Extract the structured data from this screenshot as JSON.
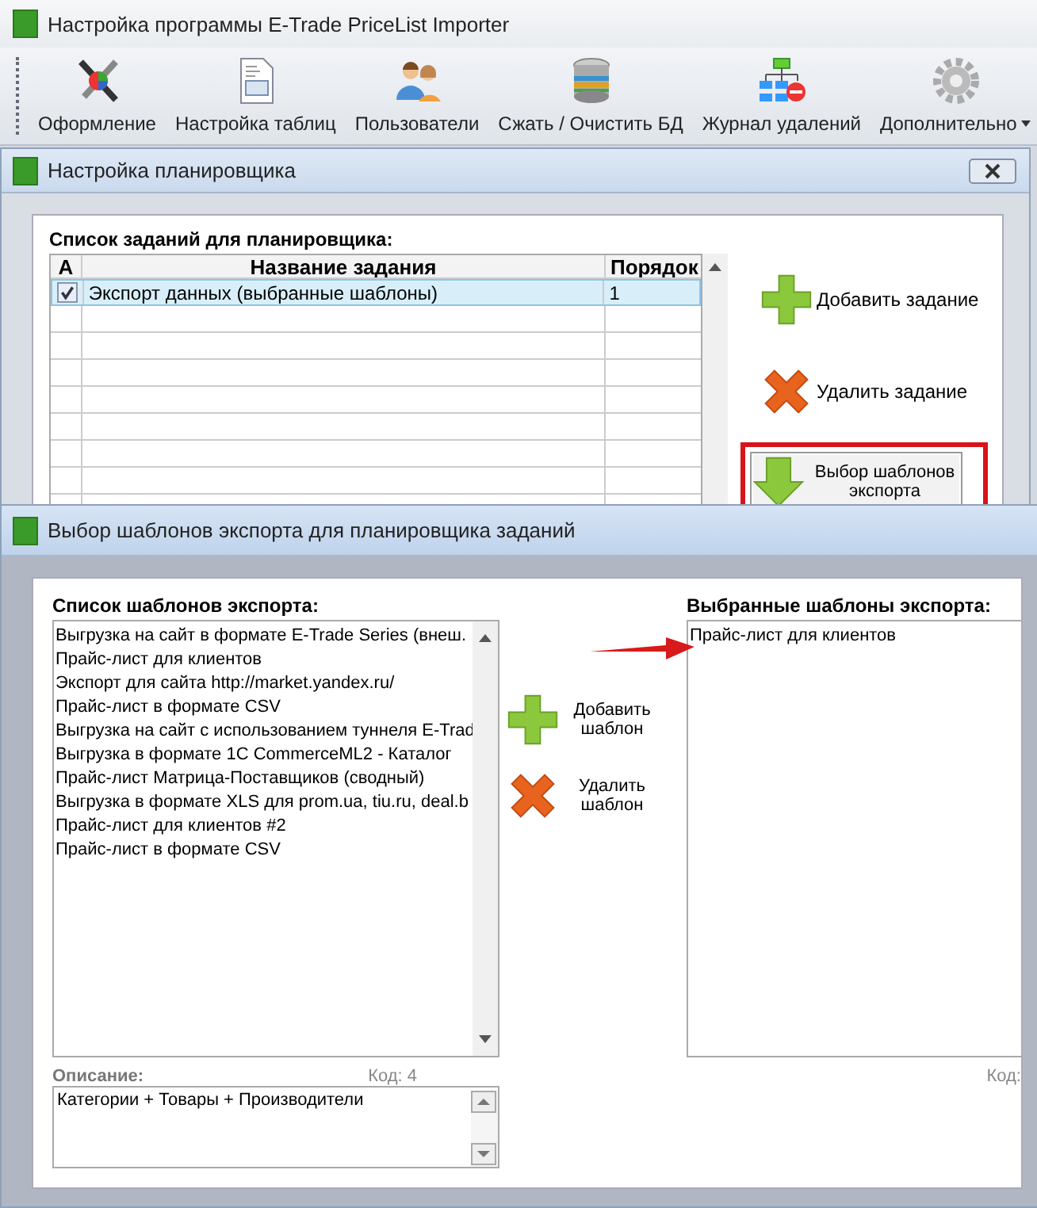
{
  "window": {
    "title": "Настройка программы E-Trade PriceList Importer"
  },
  "toolbar": [
    {
      "kind": "tools",
      "label": "Оформление",
      "menu": false
    },
    {
      "kind": "document",
      "label": "Настройка таблиц",
      "menu": false
    },
    {
      "kind": "users",
      "label": "Пользователи",
      "menu": false
    },
    {
      "kind": "database",
      "label": "Сжать / Очистить БД",
      "menu": false
    },
    {
      "kind": "hierarchy",
      "label": "Журнал удалений",
      "menu": false
    },
    {
      "kind": "gear",
      "label": "Дополнительно",
      "menu": true
    }
  ],
  "scheduler_dialog": {
    "title": "Настройка планировщика",
    "tasks_label": "Список заданий для планировщика:",
    "table": {
      "columns": [
        "А",
        "Название задания",
        "Порядок"
      ],
      "rows": [
        {
          "active": true,
          "name": "Экспорт данных (выбранные шаблоны)",
          "order": "1",
          "selected": true
        }
      ]
    },
    "buttons": [
      {
        "kind": "add",
        "label": "Добавить задание",
        "highlighted": false
      },
      {
        "kind": "delete",
        "label": "Удалить задание",
        "highlighted": false
      },
      {
        "kind": "down",
        "label": "Выбор шаблонов экспорта",
        "highlighted": true
      }
    ]
  },
  "templates_dialog": {
    "title": "Выбор шаблонов экспорта для планировщика заданий",
    "list_label": "Список шаблонов экспорта:",
    "templates": [
      "Выгрузка на сайт в формате E-Trade Series (внеш.",
      "Прайс-лист для клиентов",
      "Экспорт для сайта http://market.yandex.ru/",
      "Прайс-лист в формате CSV",
      "Выгрузка на сайт с использованием туннеля E-Trad",
      "Выгрузка в формате 1C CommerceML2 - Каталог",
      "Прайс-лист Матрица-Поставщиков (сводный)",
      "Выгрузка в формате XLS для prom.ua, tiu.ru, deal.b",
      "Прайс-лист для клиентов #2",
      "Прайс-лист в формате CSV"
    ],
    "buttons": [
      {
        "kind": "add",
        "label": "Добавить шаблон"
      },
      {
        "kind": "delete",
        "label": "Удалить шаблон"
      }
    ],
    "selected_label": "Выбранные шаблоны экспорта:",
    "selected_templates": [
      "Прайс-лист для клиентов"
    ],
    "list_code": "Код: 4",
    "selected_code": "Код:",
    "description": {
      "label": "Описание:",
      "value": "Категории + Товары + Производители"
    }
  }
}
